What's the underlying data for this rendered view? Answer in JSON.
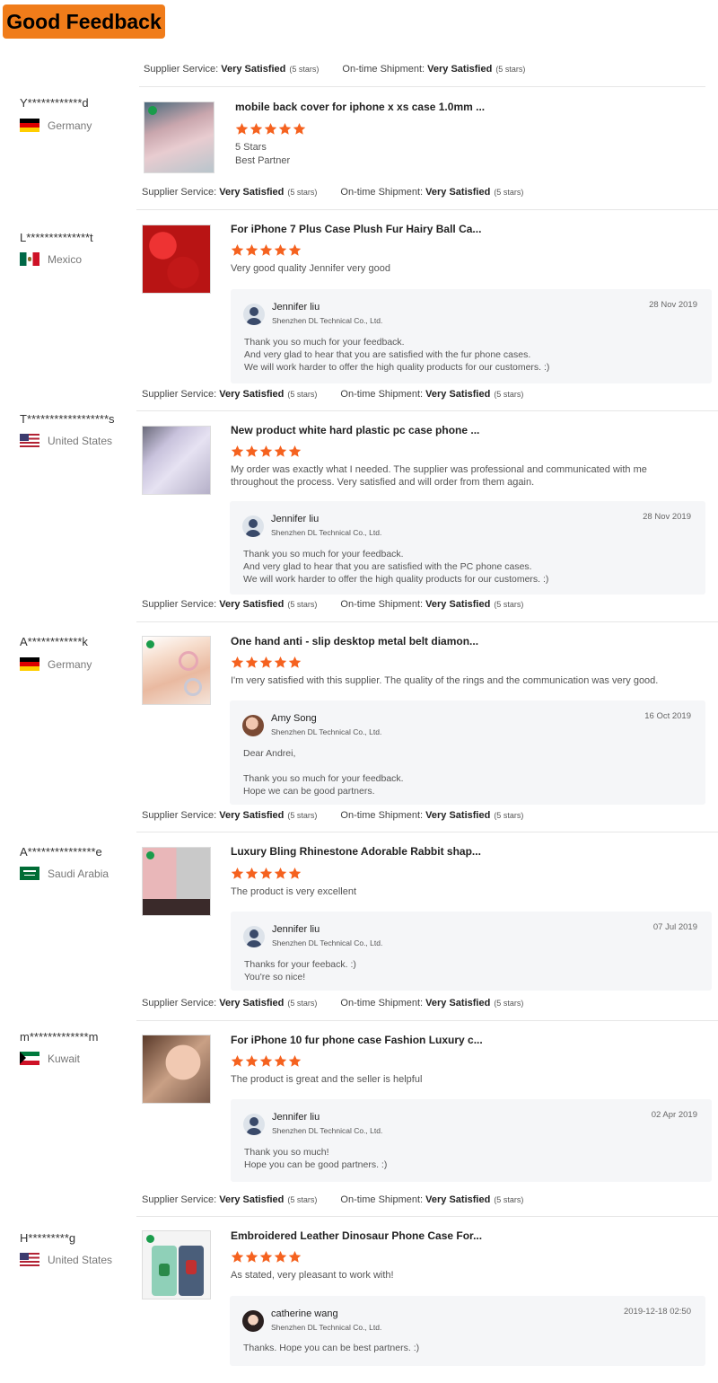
{
  "header": {
    "title": "Good Feedback"
  },
  "labels": {
    "supplier_service": "Supplier Service:",
    "ontime_shipment": "On-time Shipment:",
    "very_satisfied": "Very Satisfied",
    "five_stars": "(5 stars)",
    "rating_text": "5 Stars",
    "rating_sub": "Best Partner"
  },
  "colors": {
    "accent": "#f07c1a",
    "star": "#f5621f",
    "reply_bg": "#f5f6f8"
  },
  "reviews": [
    {
      "buyer": "Y************d",
      "country": "Germany",
      "flag": "germany-flag-icon",
      "product": "mobile back cover for iphone x xs case 1.0mm ...",
      "rating": 5,
      "comment": "",
      "reply": null
    },
    {
      "buyer": "L**************t",
      "country": "Mexico",
      "flag": "mexico-flag-icon",
      "product": "For iPhone 7 Plus Case Plush Fur Hairy Ball Ca...",
      "rating": 5,
      "comment": "Very good quality Jennifer very good",
      "reply": {
        "name": "Jennifer liu",
        "company": "Shenzhen DL Technical Co., Ltd.",
        "date": "28 Nov 2019",
        "text": "Thank you so much for your feedback.\nAnd very glad to hear that you are satisfied with the fur phone cases.\nWe will work harder to offer the high quality products for our customers. :)"
      }
    },
    {
      "buyer": "T******************s",
      "country": "United States",
      "flag": "usa-flag-icon",
      "product": "New product white hard plastic pc case phone ...",
      "rating": 5,
      "comment": "My order was exactly what I needed. The supplier was professional and communicated with me throughout the process. Very satisfied and will order from them again.",
      "reply": {
        "name": "Jennifer liu",
        "company": "Shenzhen DL Technical Co., Ltd.",
        "date": "28 Nov 2019",
        "text": "Thank you so much for your feedback.\nAnd very glad to hear that you are satisfied with the PC phone cases.\nWe will work harder to offer the high quality products for our customers. :)"
      }
    },
    {
      "buyer": "A************k",
      "country": "Germany",
      "flag": "germany-flag-icon",
      "product": "One hand anti - slip desktop metal belt diamon...",
      "rating": 5,
      "comment": "I'm very satisfied with this supplier. The quality of the rings and the communication was very good.",
      "reply": {
        "name": "Amy Song",
        "company": "Shenzhen DL Technical Co., Ltd.",
        "date": "16 Oct 2019",
        "text": "Dear Andrei,\n\nThank you so much for your feedback.\nHope we can be good partners."
      }
    },
    {
      "buyer": "A***************e",
      "country": "Saudi Arabia",
      "flag": "saudi-flag-icon",
      "product": "Luxury Bling Rhinestone Adorable Rabbit shap...",
      "rating": 5,
      "comment": "The product is very excellent",
      "reply": {
        "name": "Jennifer liu",
        "company": "Shenzhen DL Technical Co., Ltd.",
        "date": "07 Jul 2019",
        "text": "Thanks for your feeback. :)\nYou're so nice!"
      }
    },
    {
      "buyer": "m*************m",
      "country": "Kuwait",
      "flag": "kuwait-flag-icon",
      "product": "For iPhone 10 fur phone case Fashion Luxury c...",
      "rating": 5,
      "comment": "The product is great and the seller is helpful",
      "reply": {
        "name": "Jennifer liu",
        "company": "Shenzhen DL Technical Co., Ltd.",
        "date": "02 Apr 2019",
        "text": "Thank you so much!\nHope you can be good partners. :)"
      }
    },
    {
      "buyer": "H*********g",
      "country": "United States",
      "flag": "usa-flag-icon",
      "product": "Embroidered Leather Dinosaur Phone Case For...",
      "rating": 5,
      "comment": "As stated, very pleasant to work with!",
      "reply": {
        "name": "catherine wang",
        "company": "Shenzhen DL Technical Co., Ltd.",
        "date": "2019-12-18 02:50",
        "text": "Thanks. Hope you can be best partners. :)"
      }
    }
  ]
}
